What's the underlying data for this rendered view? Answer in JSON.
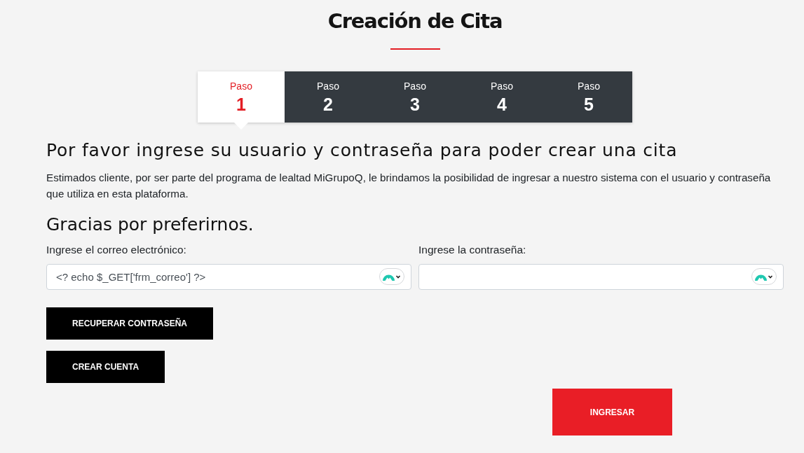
{
  "title": "Creación de Cita",
  "steps": [
    {
      "label": "Paso",
      "number": "1",
      "selected": true
    },
    {
      "label": "Paso",
      "number": "2",
      "selected": false
    },
    {
      "label": "Paso",
      "number": "3",
      "selected": false
    },
    {
      "label": "Paso",
      "number": "4",
      "selected": false
    },
    {
      "label": "Paso",
      "number": "5",
      "selected": false
    }
  ],
  "heading": "Por favor ingrese su usuario y contraseña para poder crear una cita",
  "intro": "Estimados cliente, por ser parte del programa de lealtad MiGrupoQ, le brindamos la posibilidad de ingresar a nuestro sistema con el usuario y contraseña que utiliza en esta plataforma.",
  "subheading": "Gracias por preferirnos.",
  "fields": [
    {
      "label": "Ingrese el correo electrónico:",
      "value": "<? echo $_GET['frm_correo'] ?>"
    },
    {
      "label": "Ingrese la contraseña:"
    }
  ],
  "buttons": [
    {
      "label": "RECUPERAR CONTRASEÑA",
      "kind": "secondary"
    },
    {
      "label": "CREAR CUENTA",
      "kind": "secondary"
    },
    {
      "label": "INGRESAR",
      "kind": "primary"
    }
  ]
}
